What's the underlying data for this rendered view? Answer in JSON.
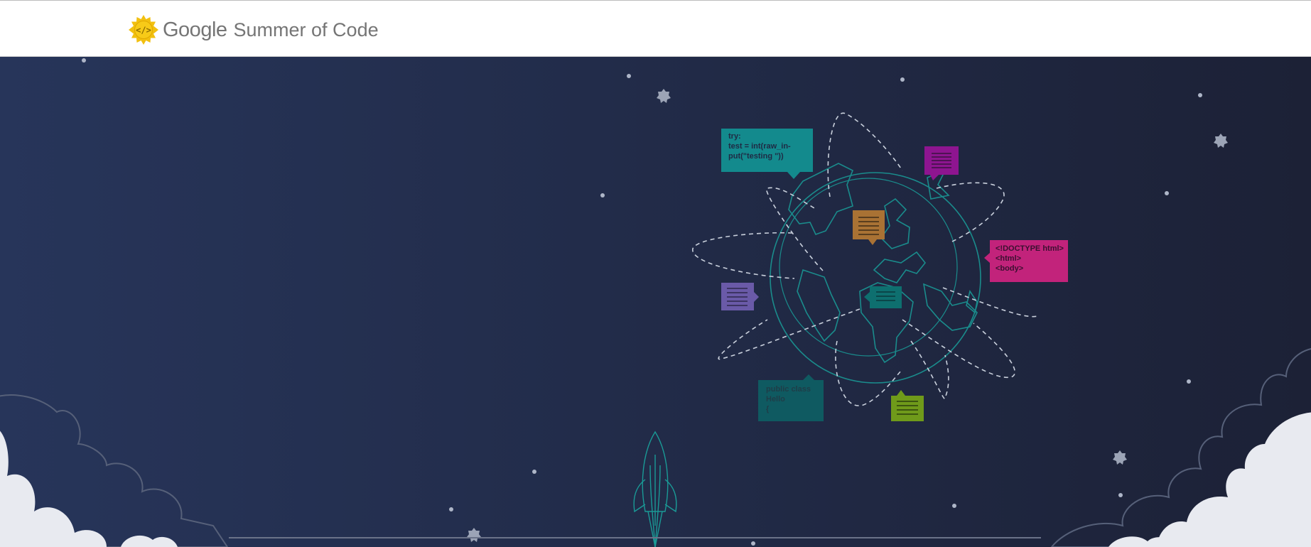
{
  "header": {
    "logo_google": "Google",
    "logo_product": "Summer of Code",
    "logo_icon": "code-brackets-sun-icon"
  },
  "hero": {
    "bubble_python": [
      "try:",
      "    test = int(raw_in-",
      "put(\"testing \"))"
    ],
    "bubble_html": [
      "<!DOCTYPE html>",
      "<html>",
      "<body>"
    ],
    "bubble_java": [
      "public class",
      "Hello",
      "{"
    ]
  },
  "colors": {
    "background_left": "#27355a",
    "background_right": "#1c2136",
    "globe_stroke": "#1a8c8c",
    "bubble_teal": "#138a8d",
    "bubble_purple": "#8e1590",
    "bubble_orange": "#a97234",
    "bubble_magenta": "#c2237b",
    "bubble_lavender": "#6a5aa8",
    "bubble_dark_teal": "#0e6f6f",
    "bubble_slate_teal": "#0f5a61",
    "bubble_green": "#6f9a1a",
    "cloud": "#e8eaf0"
  }
}
